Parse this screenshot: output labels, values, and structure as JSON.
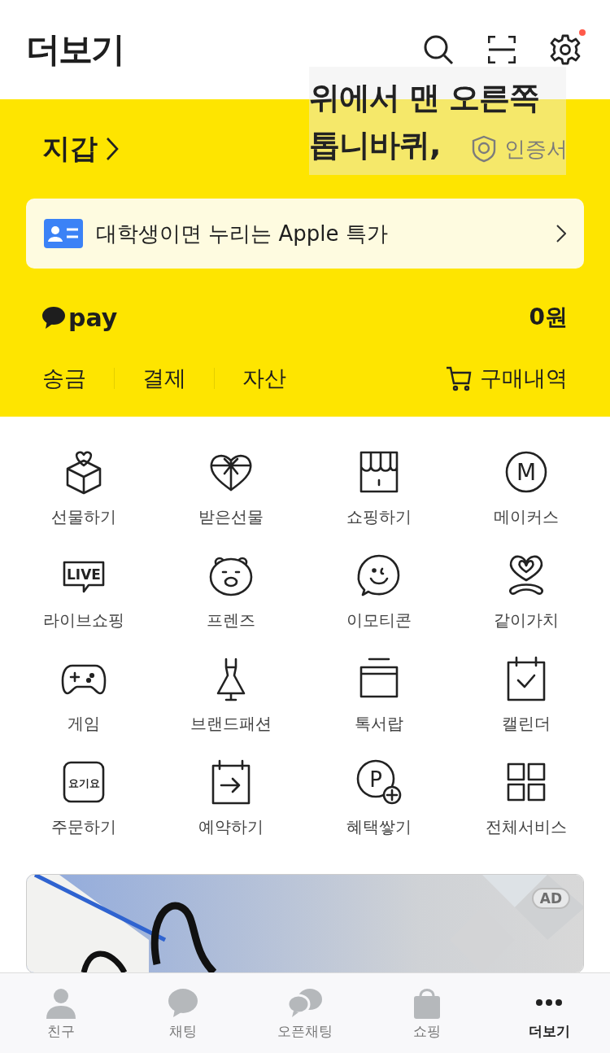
{
  "header": {
    "title": "더보기",
    "settings_badge": true
  },
  "caption": {
    "lines": [
      "위에서 맨 오른쪽",
      "톱니바퀴,"
    ]
  },
  "wallet": {
    "title": "지갑",
    "certificate": "인증서"
  },
  "promo": {
    "text": "대학생이면 누리는 Apple 특가"
  },
  "pay": {
    "logo": "pay",
    "balance": "0원",
    "links": [
      "송금",
      "결제",
      "자산"
    ],
    "history": "구매내역"
  },
  "menu": [
    {
      "kind": "gift",
      "label": "선물하기"
    },
    {
      "kind": "heartbox",
      "label": "받은선물"
    },
    {
      "kind": "store",
      "label": "쇼핑하기"
    },
    {
      "kind": "letter",
      "label": "메이커스",
      "icon_text": "M"
    },
    {
      "kind": "live",
      "label": "라이브쇼핑",
      "icon_text": "LIVE"
    },
    {
      "kind": "bear",
      "label": "프렌즈"
    },
    {
      "kind": "smile",
      "label": "이모티콘"
    },
    {
      "kind": "ribbon",
      "label": "같이가치"
    },
    {
      "kind": "gamepad",
      "label": "게임"
    },
    {
      "kind": "dress",
      "label": "브랜드패션"
    },
    {
      "kind": "drawer",
      "label": "톡서랍"
    },
    {
      "kind": "calendar",
      "label": "캘린더"
    },
    {
      "kind": "order",
      "label": "주문하기",
      "icon_text": "요기요"
    },
    {
      "kind": "reserve",
      "label": "예약하기"
    },
    {
      "kind": "points",
      "label": "혜택쌓기",
      "icon_text": "P"
    },
    {
      "kind": "grid",
      "label": "전체서비스"
    }
  ],
  "ad": {
    "badge": "AD"
  },
  "tabs": [
    {
      "kind": "person",
      "label": "친구",
      "selected": false
    },
    {
      "kind": "chat",
      "label": "채팅",
      "selected": false
    },
    {
      "kind": "openchat",
      "label": "오픈채팅",
      "selected": false
    },
    {
      "kind": "bag",
      "label": "쇼핑",
      "selected": false
    },
    {
      "kind": "more",
      "label": "더보기",
      "selected": true
    }
  ]
}
